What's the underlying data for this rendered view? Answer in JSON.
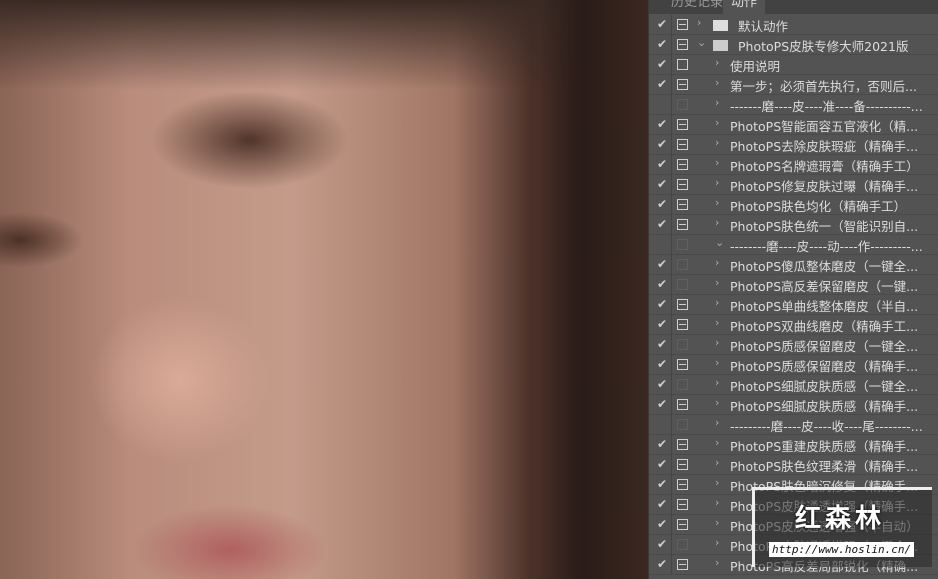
{
  "tabs": [
    "历史记录",
    "动作"
  ],
  "watermark": {
    "title": "红森林",
    "url": "http://www.hoslin.cn/"
  },
  "rows": [
    {
      "label": "默认动作",
      "check": true,
      "dlg": "line",
      "type": "folder",
      "expanded": false,
      "indent": 0
    },
    {
      "label": "PhotoPS皮肤专修大师2021版",
      "check": true,
      "dlg": "line",
      "type": "folder",
      "expanded": true,
      "indent": 0
    },
    {
      "label": "使用说明",
      "check": true,
      "dlg": "box",
      "indent": 1
    },
    {
      "label": "第一步；必须首先执行，否则后...",
      "check": true,
      "dlg": "line",
      "indent": 1
    },
    {
      "label": "-------磨----皮----准----备----------...",
      "check": false,
      "dlg": "faint",
      "indent": 1
    },
    {
      "label": "PhotoPS智能面容五官液化（精...",
      "check": true,
      "dlg": "line",
      "indent": 1
    },
    {
      "label": "PhotoPS去除皮肤瑕疵（精确手...",
      "check": true,
      "dlg": "line",
      "indent": 1
    },
    {
      "label": "PhotoPS名牌遮瑕膏（精确手工）",
      "check": true,
      "dlg": "line",
      "indent": 1
    },
    {
      "label": "PhotoPS修复皮肤过曝（精确手...",
      "check": true,
      "dlg": "line",
      "indent": 1
    },
    {
      "label": "PhotoPS肤色均化（精确手工）",
      "check": true,
      "dlg": "line",
      "indent": 1
    },
    {
      "label": "PhotoPS肤色统一（智能识别自...",
      "check": true,
      "dlg": "line",
      "indent": 1
    },
    {
      "label": "--------磨----皮----动----作---------...",
      "check": false,
      "dlg": "faint",
      "indent": 1,
      "expanded": true
    },
    {
      "label": "PhotoPS傻瓜整体磨皮（一键全...",
      "check": true,
      "dlg": "faint",
      "indent": 1
    },
    {
      "label": "PhotoPS高反差保留磨皮（一键...",
      "check": true,
      "dlg": "faint",
      "indent": 1
    },
    {
      "label": "PhotoPS单曲线整体磨皮（半自...",
      "check": true,
      "dlg": "line",
      "indent": 1
    },
    {
      "label": "PhotoPS双曲线磨皮（精确手工...",
      "check": true,
      "dlg": "line",
      "indent": 1
    },
    {
      "label": "PhotoPS质感保留磨皮（一键全...",
      "check": true,
      "dlg": "faint",
      "indent": 1
    },
    {
      "label": "PhotoPS质感保留磨皮（精确手...",
      "check": true,
      "dlg": "line",
      "indent": 1
    },
    {
      "label": "PhotoPS细腻皮肤质感（一键全...",
      "check": true,
      "dlg": "faint",
      "indent": 1
    },
    {
      "label": "PhotoPS细腻皮肤质感（精确手...",
      "check": true,
      "dlg": "line",
      "indent": 1
    },
    {
      "label": "---------磨----皮----收----尾--------...",
      "check": false,
      "dlg": "faint",
      "indent": 1
    },
    {
      "label": "PhotoPS重建皮肤质感（精确手...",
      "check": true,
      "dlg": "line",
      "indent": 1
    },
    {
      "label": "PhotoPS肤色纹理柔滑（精确手...",
      "check": true,
      "dlg": "line",
      "indent": 1
    },
    {
      "label": "PhotoPS肤色暗沉修复（精确手...",
      "check": true,
      "dlg": "line",
      "indent": 1
    },
    {
      "label": "PhotoPS皮肤通透增强（精确手...",
      "check": true,
      "dlg": "line",
      "indent": 1
    },
    {
      "label": "PhotoPS皮肤通透增强（半自动）",
      "check": true,
      "dlg": "line",
      "indent": 1
    },
    {
      "label": "PhotoPS皮肤通透增强（一键全...",
      "check": true,
      "dlg": "faint",
      "indent": 1
    },
    {
      "label": "PhotoPS高反差局部锐化（精确...",
      "check": true,
      "dlg": "line",
      "indent": 1
    }
  ]
}
